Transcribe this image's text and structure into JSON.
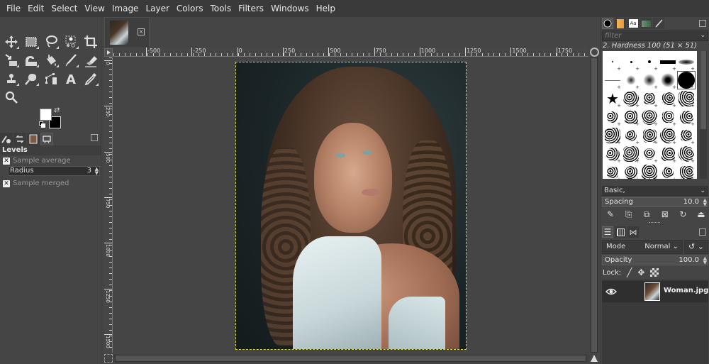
{
  "menubar": {
    "items": [
      "File",
      "Edit",
      "Select",
      "View",
      "Image",
      "Layer",
      "Colors",
      "Tools",
      "Filters",
      "Windows",
      "Help"
    ]
  },
  "toolbox": {
    "tools": [
      {
        "name": "move-tool",
        "icon": "move-icon"
      },
      {
        "name": "rect-select-tool",
        "icon": "rect-select-icon"
      },
      {
        "name": "free-select-tool",
        "icon": "lasso-icon"
      },
      {
        "name": "fuzzy-select-tool",
        "icon": "fuzzy-select-icon"
      },
      {
        "name": "crop-tool",
        "icon": "crop-icon"
      },
      {
        "name": "transform-tool",
        "icon": "unified-transform-icon"
      },
      {
        "name": "warp-tool",
        "icon": "warp-transform-icon"
      },
      {
        "name": "bucket-fill-tool",
        "icon": "bucket-fill-icon"
      },
      {
        "name": "paintbrush-tool",
        "icon": "paintbrush-icon"
      },
      {
        "name": "eraser-tool",
        "icon": "eraser-icon"
      },
      {
        "name": "clone-tool",
        "icon": "clone-stamp-icon"
      },
      {
        "name": "smudge-tool",
        "icon": "smudge-icon"
      },
      {
        "name": "paths-tool",
        "icon": "paths-icon"
      },
      {
        "name": "text-tool",
        "icon": "text-icon"
      },
      {
        "name": "color-picker-tool",
        "icon": "color-picker-icon"
      },
      {
        "name": "zoom-tool",
        "icon": "zoom-icon"
      }
    ],
    "fg_color": "#ffffff",
    "bg_color": "#000000",
    "tool_options": {
      "title": "Levels",
      "sample_average_label": "Sample average",
      "radius_label": "Radius",
      "radius_value": "3",
      "sample_merged_label": "Sample merged"
    }
  },
  "image_tabs": {
    "close_glyph": "×"
  },
  "rulers": {
    "horizontal": [
      "-500",
      "-250",
      "0",
      "250",
      "500",
      "750",
      "1000",
      "1250",
      "1500",
      "1750"
    ],
    "vertical": [
      "0",
      "250",
      "500",
      "750",
      "1000",
      "1250",
      "1500"
    ]
  },
  "canvas": {
    "selection_color": "#d8d440"
  },
  "brushes": {
    "filter_placeholder": "filter",
    "selected_brush": "2. Hardness 100 (51 × 51)",
    "preset": "Basic,",
    "spacing_label": "Spacing",
    "spacing_value": "10.0"
  },
  "layers": {
    "mode_label": "Mode",
    "mode_value": "Normal",
    "opacity_label": "Opacity",
    "opacity_value": "100.0",
    "lock_label": "Lock:",
    "items": [
      {
        "name": "Woman.jpg",
        "visible": true
      }
    ]
  }
}
